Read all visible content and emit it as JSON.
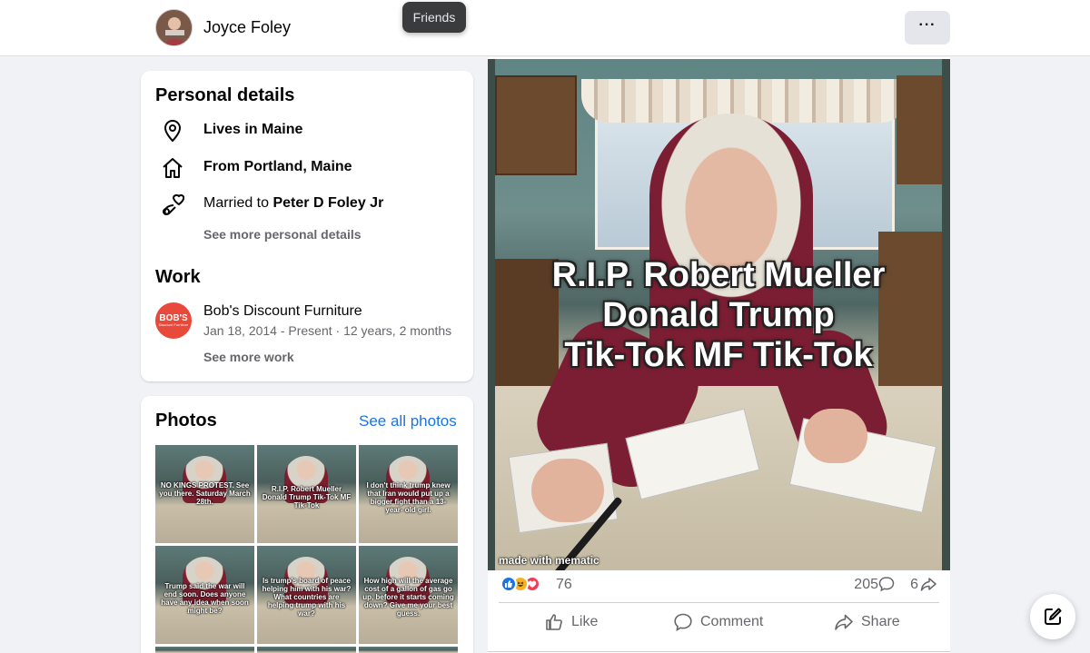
{
  "header": {
    "profile_name": "Joyce Foley",
    "tooltip": "Friends",
    "more_label": "···",
    "icons": {
      "avatar": "avatar",
      "more": "more-dots-icon"
    }
  },
  "personal_details": {
    "title": "Personal details",
    "items": [
      {
        "icon": "location-pin-icon",
        "text": "Lives in Maine"
      },
      {
        "icon": "home-icon",
        "text": "From Portland, Maine"
      },
      {
        "icon": "relationship-hearts-icon",
        "prefix": "Married to ",
        "name": "Peter D Foley Jr"
      }
    ],
    "see_more": "See more personal details"
  },
  "work": {
    "title": "Work",
    "logo_text": "BOB'S",
    "logo_subtext": "Discount Furniture",
    "employer": "Bob's Discount Furniture",
    "dates": "Jan 18, 2014 - Present · 12 years, 2 months",
    "see_more": "See more work"
  },
  "photos": {
    "title": "Photos",
    "see_all": "See all photos",
    "thumbnails": [
      "NO KINGS PROTEST. See you there. Saturday March 28th.",
      "R.I.P. Robert Mueller Donald Trump Tik-Tok MF Tik-Tok",
      "I don't think trump knew that Iran would put up a bigger fight than a 13-year- old girl.",
      "Trump said the war will end soon. Does anyone have any idea when soon might be?",
      "Is trump's board of peace helping him with his war? What countries are helping trump with his war?",
      "How high will the average cost of a gallon of gas go up, before it starts coming down? Give me your best guess."
    ]
  },
  "post": {
    "meme_lines": [
      "R.I.P.  Robert Mueller",
      "Donald Trump",
      "Tik-Tok  MF  Tik-Tok"
    ],
    "watermark": "made with mematic",
    "reactions": {
      "types": [
        "like",
        "haha",
        "love"
      ],
      "count": "76",
      "comments": "205",
      "shares": "6"
    },
    "actions": {
      "like": "Like",
      "comment": "Comment",
      "share": "Share"
    }
  },
  "colors": {
    "accent": "#1b74e4",
    "like": "#1b74e4",
    "haha": "#f7b125",
    "love": "#f33e58",
    "shirt": "#7b1e33",
    "logo": "#e8493b"
  },
  "fab": {
    "icon": "compose-edit-icon"
  }
}
